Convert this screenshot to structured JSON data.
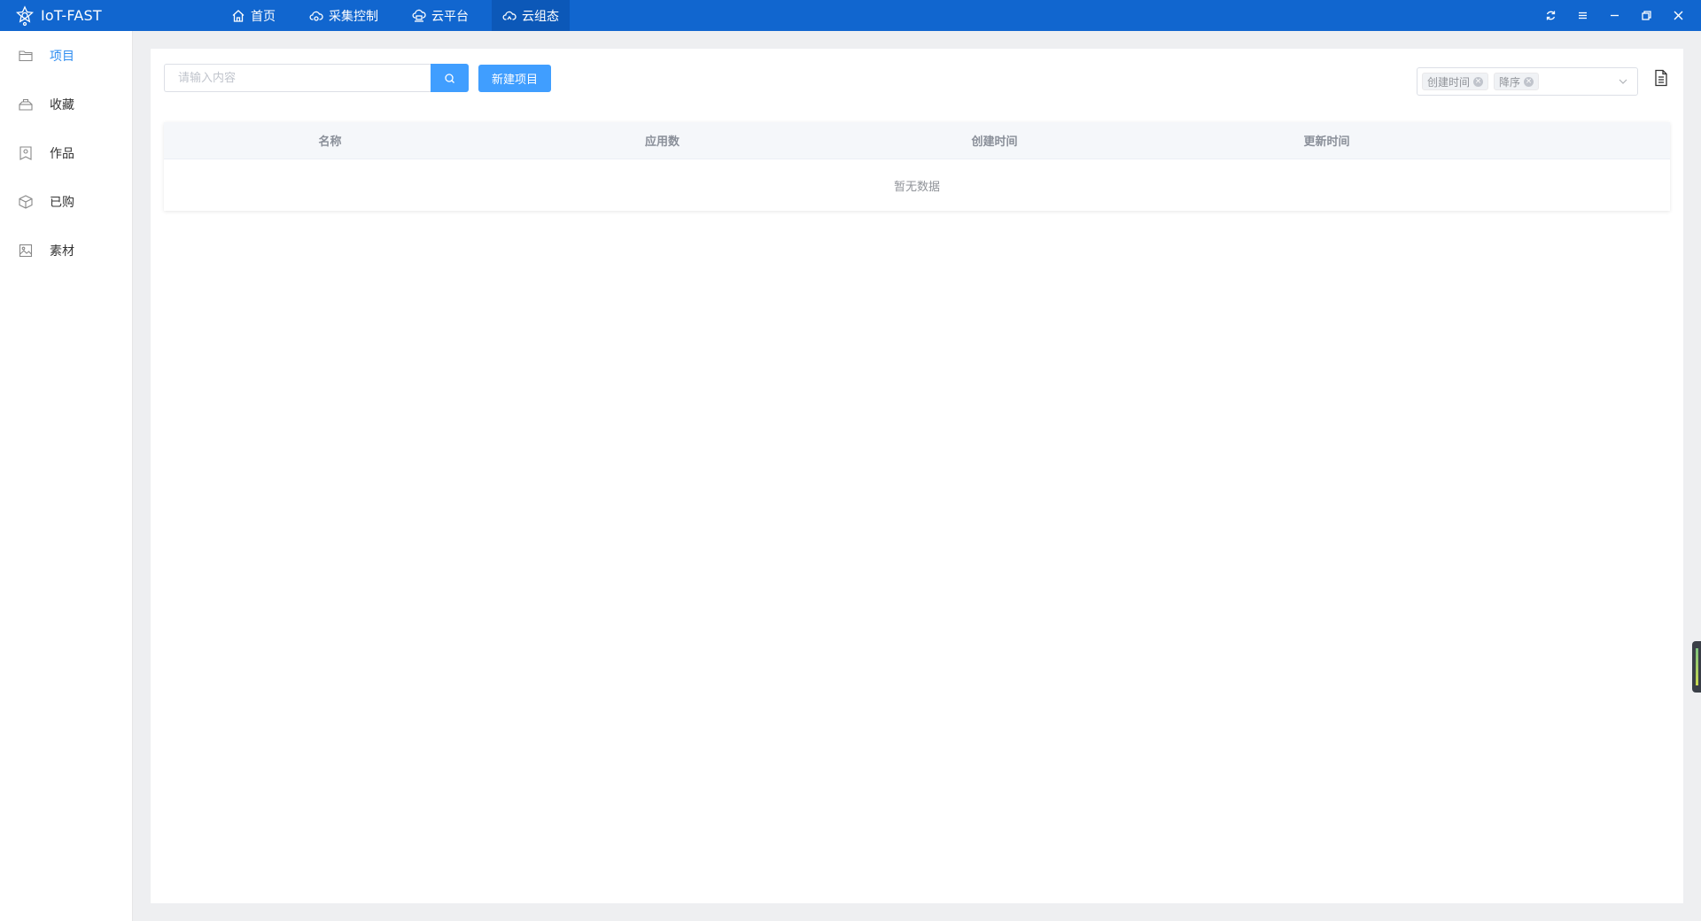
{
  "app": {
    "title": "IoT-FAST",
    "brand_color": "#1166cf",
    "accent_color": "#409eff"
  },
  "nav": {
    "items": [
      {
        "label": "首页",
        "icon": "home-icon"
      },
      {
        "label": "采集控制",
        "icon": "cloud-collect-icon"
      },
      {
        "label": "云平台",
        "icon": "cloud-platform-icon"
      },
      {
        "label": "云组态",
        "icon": "cloud-config-icon",
        "active": true
      }
    ]
  },
  "window_controls": [
    "refresh-icon",
    "menu-icon",
    "minimize-icon",
    "restore-icon",
    "close-icon"
  ],
  "sidebar": {
    "items": [
      {
        "label": "项目",
        "icon": "folder-icon",
        "active": true
      },
      {
        "label": "收藏",
        "icon": "collect-icon"
      },
      {
        "label": "作品",
        "icon": "works-icon"
      },
      {
        "label": "已购",
        "icon": "purchased-box-icon"
      },
      {
        "label": "素材",
        "icon": "image-icon"
      }
    ]
  },
  "toolbar": {
    "search_placeholder": "请输入内容",
    "search_value": "",
    "new_button": "新建项目"
  },
  "sort": {
    "tags": [
      "创建时间",
      "降序"
    ]
  },
  "table": {
    "columns": [
      "名称",
      "应用数",
      "创建时间",
      "更新时间"
    ],
    "rows": [],
    "empty_text": "暂无数据"
  }
}
